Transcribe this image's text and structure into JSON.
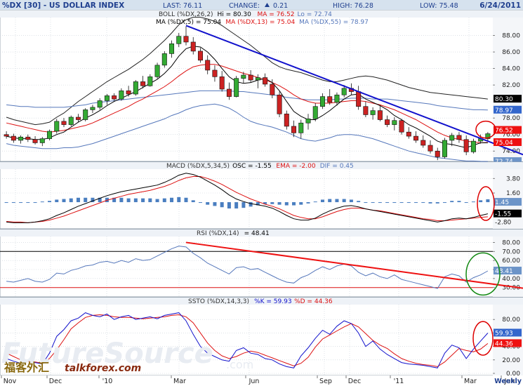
{
  "header": {
    "symbol": "%DX [30] - US DOLLAR INDEX",
    "last": "LAST: 76.11",
    "change_label": "CHANGE:",
    "change_value": "0.21",
    "high": "HIGH: 76.28",
    "low": "LOW: 75.48",
    "date": "6/24/2011"
  },
  "colors": {
    "title_bar": "#d6e2ee",
    "header_text": "#1f3f8f",
    "grid": "#c8d0d8",
    "candle_up": "#33aa33",
    "candle_down": "#cc2222",
    "sma_black": "#000000",
    "ma_red": "#dd1111",
    "ma_blue_band": "#5577bb",
    "boll_line": "#222222",
    "trend_blue": "#1111cc",
    "trend_red": "#ee1111",
    "hist_blue": "#4a7ec0",
    "box_black": "#000000",
    "box_red": "#ee1111",
    "box_blue": "#3366cc",
    "box_light_blue": "#6c94c8",
    "highlight_red": "#dd0000",
    "highlight_green": "#118811"
  },
  "chart_data": [
    {
      "id": "price",
      "type": "candlestick",
      "title": "BOLL (%DX,26,2) Hi = 80.30 MA = 76.52 Lo = 72.74",
      "legend": {
        "boll": "BOLL (%DX,26,2)",
        "hi": "Hi = 80.30",
        "ma": "MA = 76.52",
        "lo": "Lo = 72.74",
        "ma2_prefix": "MA (%DX,5) = 75.04",
        "ma2_mid": "MA (%DX,13) = 75.04",
        "ma2_last": "MA (%DX,55) = 78.97"
      },
      "ylim": [
        73,
        90
      ],
      "y_ticks": [
        76.0,
        78.0,
        82.0,
        84.0,
        86.0,
        88.0,
        74.0
      ],
      "y_tick_labels": [
        "76.00",
        "78.00",
        "82.00",
        "84.00",
        "86.00",
        "88.00",
        "74.00"
      ],
      "last_labels": [
        "80.30",
        "78.97",
        "76.52",
        "75.04",
        "72.74"
      ],
      "candles": [
        [
          76.0,
          76.4,
          75.5,
          75.8
        ],
        [
          75.8,
          76.1,
          75.0,
          75.3
        ],
        [
          75.3,
          75.9,
          74.9,
          75.7
        ],
        [
          75.7,
          76.0,
          75.1,
          75.4
        ],
        [
          75.4,
          75.8,
          74.8,
          75.0
        ],
        [
          75.0,
          75.7,
          74.6,
          75.5
        ],
        [
          75.5,
          76.6,
          75.3,
          76.4
        ],
        [
          76.4,
          77.9,
          76.1,
          77.6
        ],
        [
          77.6,
          78.0,
          76.9,
          77.2
        ],
        [
          77.2,
          78.3,
          77.0,
          78.1
        ],
        [
          78.1,
          78.5,
          77.5,
          77.8
        ],
        [
          77.8,
          79.2,
          77.6,
          79.0
        ],
        [
          79.0,
          79.6,
          78.6,
          79.3
        ],
        [
          79.3,
          80.4,
          79.0,
          80.1
        ],
        [
          80.1,
          80.9,
          79.6,
          80.7
        ],
        [
          80.7,
          81.0,
          80.1,
          80.3
        ],
        [
          80.3,
          81.6,
          80.1,
          81.3
        ],
        [
          81.3,
          81.9,
          80.6,
          80.9
        ],
        [
          80.9,
          82.6,
          80.7,
          82.4
        ],
        [
          82.4,
          83.1,
          81.6,
          81.9
        ],
        [
          81.9,
          83.3,
          81.8,
          83.0
        ],
        [
          83.0,
          84.7,
          82.8,
          84.4
        ],
        [
          84.4,
          86.1,
          84.1,
          85.8
        ],
        [
          85.8,
          87.4,
          85.3,
          87.0
        ],
        [
          87.0,
          88.3,
          86.6,
          87.9
        ],
        [
          87.9,
          89.1,
          86.8,
          87.2
        ],
        [
          87.2,
          87.8,
          85.7,
          86.1
        ],
        [
          86.1,
          86.5,
          84.7,
          85.0
        ],
        [
          85.0,
          85.6,
          83.3,
          83.8
        ],
        [
          83.8,
          84.4,
          82.4,
          83.0
        ],
        [
          83.0,
          83.7,
          81.2,
          81.5
        ],
        [
          81.5,
          82.3,
          80.2,
          80.6
        ],
        [
          80.6,
          83.1,
          80.5,
          82.8
        ],
        [
          82.8,
          83.6,
          82.2,
          83.2
        ],
        [
          83.2,
          83.8,
          82.3,
          82.6
        ],
        [
          82.6,
          83.3,
          81.6,
          82.9
        ],
        [
          82.9,
          83.4,
          81.8,
          82.1
        ],
        [
          82.1,
          82.7,
          80.4,
          80.8
        ],
        [
          80.8,
          81.2,
          78.1,
          78.5
        ],
        [
          78.5,
          78.9,
          76.6,
          77.0
        ],
        [
          77.0,
          77.7,
          75.7,
          76.2
        ],
        [
          76.2,
          77.8,
          75.5,
          77.4
        ],
        [
          77.4,
          78.5,
          76.6,
          77.9
        ],
        [
          77.9,
          79.8,
          77.6,
          79.4
        ],
        [
          79.4,
          81.0,
          79.1,
          80.6
        ],
        [
          80.6,
          81.5,
          79.6,
          79.9
        ],
        [
          79.9,
          81.1,
          79.5,
          80.8
        ],
        [
          80.8,
          82.0,
          80.5,
          81.6
        ],
        [
          81.6,
          82.2,
          80.8,
          81.2
        ],
        [
          81.2,
          81.9,
          79.0,
          79.4
        ],
        [
          79.4,
          80.0,
          78.1,
          78.4
        ],
        [
          78.4,
          79.3,
          77.8,
          78.9
        ],
        [
          78.9,
          79.5,
          77.6,
          77.8
        ],
        [
          77.8,
          78.3,
          76.9,
          77.2
        ],
        [
          77.2,
          78.1,
          76.5,
          77.7
        ],
        [
          77.7,
          77.9,
          76.0,
          76.3
        ],
        [
          76.3,
          76.9,
          75.5,
          75.8
        ],
        [
          75.8,
          76.4,
          75.0,
          75.3
        ],
        [
          75.3,
          75.9,
          74.4,
          74.7
        ],
        [
          74.7,
          75.3,
          73.7,
          74.0
        ],
        [
          74.0,
          74.4,
          72.9,
          73.3
        ],
        [
          73.3,
          75.6,
          73.1,
          75.3
        ],
        [
          75.3,
          76.2,
          74.6,
          75.9
        ],
        [
          75.9,
          76.3,
          75.0,
          75.4
        ],
        [
          75.4,
          75.9,
          73.5,
          73.9
        ],
        [
          73.9,
          75.5,
          73.7,
          75.2
        ],
        [
          75.2,
          76.0,
          74.9,
          75.5
        ],
        [
          75.5,
          76.3,
          75.2,
          76.1
        ]
      ],
      "sma5": [
        75.8,
        75.6,
        75.5,
        75.5,
        75.4,
        75.4,
        75.6,
        76.0,
        76.3,
        76.9,
        77.5,
        78.0,
        78.4,
        78.9,
        79.5,
        80.0,
        80.4,
        80.8,
        81.2,
        81.7,
        82.2,
        82.7,
        83.4,
        84.3,
        85.5,
        86.4,
        86.7,
        86.6,
        86.0,
        85.1,
        84.0,
        83.0,
        82.4,
        82.2,
        82.3,
        82.6,
        82.8,
        82.3,
        81.3,
        80.0,
        78.8,
        78.2,
        77.8,
        77.8,
        78.3,
        78.9,
        79.6,
        80.3,
        80.8,
        80.9,
        80.3,
        79.9,
        79.5,
        79.0,
        78.3,
        77.8,
        77.2,
        76.8,
        76.3,
        75.8,
        75.2,
        74.9,
        74.8,
        74.6,
        74.4,
        74.7,
        75.0,
        75.0
      ],
      "ma13": [
        77.4,
        77.2,
        77.0,
        76.8,
        76.6,
        76.4,
        76.3,
        76.4,
        76.5,
        76.7,
        76.9,
        77.1,
        77.4,
        77.8,
        78.2,
        78.6,
        79.0,
        79.4,
        79.9,
        80.3,
        80.8,
        81.3,
        81.8,
        82.4,
        83.1,
        83.7,
        84.2,
        84.4,
        84.5,
        84.5,
        84.3,
        84.0,
        83.7,
        83.4,
        83.2,
        82.9,
        82.6,
        82.3,
        81.9,
        81.4,
        80.8,
        80.3,
        80.0,
        79.8,
        79.8,
        79.8,
        79.9,
        80.0,
        80.1,
        80.1,
        80.0,
        79.8,
        79.6,
        79.3,
        79.0,
        78.6,
        78.2,
        77.8,
        77.3,
        76.8,
        76.3,
        75.9,
        75.6,
        75.4,
        75.2,
        75.1,
        75.0,
        75.04
      ],
      "ma55": [
        79.6,
        79.5,
        79.4,
        79.4,
        79.3,
        79.3,
        79.3,
        79.3,
        79.3,
        79.4,
        79.5,
        79.6,
        79.8,
        79.9,
        80.0,
        80.1,
        80.2,
        80.3,
        80.4,
        80.5,
        80.6,
        80.7,
        80.8,
        80.9,
        81.0,
        81.1,
        81.2,
        81.3,
        81.3,
        81.3,
        81.3,
        81.3,
        81.2,
        81.2,
        81.1,
        81.0,
        80.9,
        80.8,
        80.7,
        80.5,
        80.4,
        80.3,
        80.2,
        80.2,
        80.2,
        80.2,
        80.3,
        80.3,
        80.4,
        80.4,
        80.4,
        80.3,
        80.3,
        80.3,
        80.2,
        80.1,
        80.0,
        79.9,
        79.8,
        79.7,
        79.5,
        79.4,
        79.3,
        79.2,
        79.1,
        79.0,
        79.0,
        78.97
      ],
      "boll_upper": [
        78.1,
        77.8,
        77.6,
        77.4,
        77.2,
        77.3,
        77.5,
        78.1,
        78.6,
        79.3,
        80.0,
        80.6,
        81.2,
        81.8,
        82.4,
        82.9,
        83.4,
        83.9,
        84.5,
        85.1,
        85.8,
        86.6,
        87.4,
        88.3,
        89.3,
        89.9,
        90.2,
        90.2,
        90.0,
        89.7,
        89.2,
        88.6,
        88.0,
        87.4,
        86.8,
        86.1,
        85.4,
        84.7,
        84.2,
        83.9,
        83.7,
        83.5,
        83.2,
        82.9,
        82.6,
        82.4,
        82.4,
        82.6,
        82.8,
        83.0,
        83.1,
        83.0,
        82.8,
        82.6,
        82.3,
        82.0,
        81.7,
        81.5,
        81.3,
        81.1,
        81.0,
        80.9,
        80.8,
        80.7,
        80.6,
        80.5,
        80.4,
        80.3
      ],
      "boll_lower": [
        74.9,
        74.7,
        74.6,
        74.5,
        74.4,
        74.3,
        74.3,
        74.3,
        74.4,
        74.4,
        74.5,
        74.7,
        74.9,
        75.2,
        75.5,
        75.8,
        76.1,
        76.4,
        76.7,
        77.0,
        77.3,
        77.6,
        77.9,
        78.3,
        78.6,
        79.0,
        79.3,
        79.5,
        79.6,
        79.7,
        79.5,
        79.2,
        78.7,
        78.1,
        77.6,
        77.3,
        77.1,
        76.9,
        76.6,
        76.3,
        75.9,
        75.5,
        75.3,
        75.2,
        75.4,
        75.6,
        75.9,
        76.0,
        76.0,
        75.9,
        75.7,
        75.5,
        75.2,
        74.9,
        74.6,
        74.3,
        74.0,
        73.8,
        73.6,
        73.4,
        73.2,
        73.1,
        73.0,
        72.9,
        72.8,
        72.8,
        72.75,
        72.74
      ],
      "trendline": [
        [
          25,
          89.2
        ],
        [
          67.6,
          75.0
        ]
      ]
    },
    {
      "id": "macd",
      "type": "macd",
      "title": "MACD (%DX,5,34,5) OSC = -1.55 EMA = -2.00 DIF = 0.45",
      "legend": {
        "prefix": "MACD (%DX,5,34,5)",
        "osc": "OSC = -1.55",
        "ema": "EMA = -2.00",
        "dif": "DIF = 0.45"
      },
      "ylim": [
        -3.5,
        5.0
      ],
      "y_ticks": [
        3.8,
        1.6
      ],
      "y_tick_labels": [
        "3.80",
        "1.60"
      ],
      "last_labels": [
        "1.45",
        "-1.55",
        "-2.80"
      ],
      "osc": [
        -2.8,
        -2.9,
        -2.9,
        -2.9,
        -2.8,
        -2.6,
        -2.3,
        -1.8,
        -1.4,
        -0.9,
        -0.4,
        0.0,
        0.4,
        0.8,
        1.2,
        1.5,
        1.8,
        2.0,
        2.2,
        2.4,
        2.6,
        2.8,
        3.2,
        3.7,
        4.3,
        4.6,
        4.4,
        4.0,
        3.4,
        2.8,
        2.1,
        1.3,
        0.7,
        0.3,
        0.0,
        -0.2,
        -0.4,
        -0.7,
        -1.2,
        -1.8,
        -2.3,
        -2.5,
        -2.5,
        -2.2,
        -1.6,
        -1.1,
        -0.7,
        -0.4,
        -0.3,
        -0.5,
        -0.8,
        -1.0,
        -1.2,
        -1.4,
        -1.6,
        -1.8,
        -2.0,
        -2.2,
        -2.4,
        -2.6,
        -2.8,
        -2.6,
        -2.3,
        -2.2,
        -2.3,
        -2.1,
        -1.8,
        -1.55
      ],
      "ema": [
        -2.7,
        -2.8,
        -2.8,
        -2.9,
        -2.8,
        -2.7,
        -2.5,
        -2.2,
        -1.9,
        -1.5,
        -1.1,
        -0.7,
        -0.3,
        0.1,
        0.5,
        0.8,
        1.1,
        1.4,
        1.6,
        1.8,
        2.0,
        2.3,
        2.6,
        3.0,
        3.5,
        3.9,
        4.1,
        4.1,
        3.8,
        3.4,
        2.9,
        2.3,
        1.7,
        1.2,
        0.7,
        0.3,
        -0.1,
        -0.4,
        -0.8,
        -1.3,
        -1.8,
        -2.1,
        -2.3,
        -2.3,
        -2.0,
        -1.6,
        -1.2,
        -0.9,
        -0.7,
        -0.7,
        -0.8,
        -1.0,
        -1.1,
        -1.3,
        -1.5,
        -1.7,
        -1.9,
        -2.1,
        -2.3,
        -2.4,
        -2.6,
        -2.6,
        -2.5,
        -2.4,
        -2.3,
        -2.2,
        -2.1,
        -2.0
      ],
      "hist": [
        -0.1,
        -0.1,
        -0.1,
        0.0,
        0.0,
        0.1,
        0.2,
        0.4,
        0.5,
        0.6,
        0.7,
        0.7,
        0.7,
        0.7,
        0.7,
        0.7,
        0.7,
        0.6,
        0.6,
        0.6,
        0.6,
        0.5,
        0.6,
        0.7,
        0.8,
        0.7,
        0.3,
        -0.1,
        -0.4,
        -0.6,
        -0.8,
        -1.0,
        -1.0,
        -0.9,
        -0.7,
        -0.5,
        -0.3,
        -0.3,
        -0.4,
        -0.5,
        -0.5,
        -0.4,
        -0.2,
        0.1,
        0.4,
        0.5,
        0.5,
        0.5,
        0.4,
        0.2,
        0.0,
        0.0,
        -0.1,
        -0.1,
        -0.1,
        -0.1,
        -0.1,
        -0.1,
        -0.1,
        -0.2,
        -0.2,
        0.0,
        0.2,
        0.2,
        0.0,
        0.1,
        0.3,
        0.45
      ]
    },
    {
      "id": "rsi",
      "type": "line",
      "title": "RSI (%DX,14) = 48.41",
      "legend": {
        "prefix": "RSI (%DX,14)",
        "value": "= 48.41"
      },
      "ylim": [
        22,
        85
      ],
      "y_ticks": [
        80,
        70,
        60,
        50,
        40,
        30
      ],
      "y_tick_labels": [
        "80.00",
        "70.00",
        "60.00",
        "50.00",
        "40.00",
        "30.00"
      ],
      "last_labels": [
        "48.41"
      ],
      "ref_levels": [
        70,
        30
      ],
      "values": [
        37,
        36,
        38,
        40,
        37,
        36,
        39,
        46,
        45,
        49,
        51,
        54,
        55,
        58,
        59,
        57,
        60,
        58,
        62,
        60,
        61,
        65,
        69,
        73,
        76,
        75,
        68,
        63,
        57,
        53,
        49,
        45,
        52,
        53,
        50,
        51,
        47,
        43,
        39,
        36,
        35,
        41,
        44,
        49,
        53,
        50,
        54,
        56,
        54,
        47,
        43,
        46,
        42,
        40,
        44,
        39,
        37,
        35,
        33,
        31,
        29,
        42,
        45,
        43,
        36,
        41,
        44,
        48.41
      ],
      "trendline": [
        [
          25,
          80.0
        ],
        [
          68,
          33.5
        ]
      ]
    },
    {
      "id": "ssto",
      "type": "line",
      "title": "SSTO (%DX,14,3,3) %K = 59.93 %D = 44.36",
      "legend": {
        "prefix": "SSTO (%DX,14,3,3)",
        "k": "%K = 59.93",
        "d": "%D = 44.36"
      },
      "ylim": [
        0,
        100
      ],
      "y_ticks": [
        80,
        60,
        40,
        20,
        0
      ],
      "y_tick_labels": [
        "80.00",
        "60.00",
        "40.00",
        "20.00",
        "0.00"
      ],
      "last_labels": [
        "59.93",
        "44.36"
      ],
      "k": [
        22,
        18,
        15,
        20,
        16,
        14,
        30,
        55,
        65,
        78,
        82,
        90,
        86,
        84,
        88,
        80,
        84,
        86,
        80,
        82,
        84,
        81,
        86,
        88,
        90,
        78,
        58,
        40,
        30,
        25,
        20,
        18,
        34,
        38,
        30,
        28,
        22,
        20,
        14,
        10,
        8,
        26,
        38,
        52,
        64,
        58,
        70,
        78,
        74,
        60,
        40,
        48,
        36,
        28,
        22,
        16,
        14,
        13,
        12,
        10,
        8,
        30,
        42,
        38,
        22,
        36,
        48,
        59.93
      ],
      "d": [
        30,
        25,
        20,
        18,
        17,
        15,
        22,
        35,
        50,
        66,
        75,
        83,
        86,
        87,
        86,
        84,
        83,
        83,
        82,
        81,
        82,
        83,
        84,
        86,
        87,
        84,
        75,
        60,
        45,
        34,
        26,
        22,
        25,
        30,
        33,
        31,
        27,
        23,
        19,
        15,
        11,
        15,
        24,
        39,
        51,
        57,
        63,
        69,
        74,
        69,
        59,
        49,
        42,
        37,
        29,
        22,
        18,
        15,
        13,
        12,
        10,
        17,
        27,
        37,
        34,
        32,
        36,
        44.36
      ]
    }
  ],
  "x_axis": {
    "labels": [
      "Nov",
      "Dec",
      "'10",
      "Mar",
      "Jun",
      "Sep",
      "Dec",
      "'11",
      "Mar",
      "Jun",
      "Weekly"
    ]
  },
  "watermark": {
    "brand": "FutureSource",
    "suffix": ".com",
    "cn_text": "福客外汇",
    "site_text": "talkforex.com"
  }
}
